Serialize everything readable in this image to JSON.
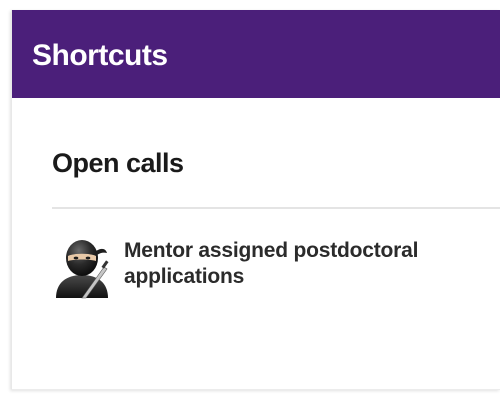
{
  "header": {
    "title": "Shortcuts",
    "background_color": "#4b1f7a"
  },
  "section": {
    "title": "Open calls"
  },
  "items": [
    {
      "label": "Mentor assigned postdoctoral applications",
      "icon": "ninja-icon"
    }
  ]
}
